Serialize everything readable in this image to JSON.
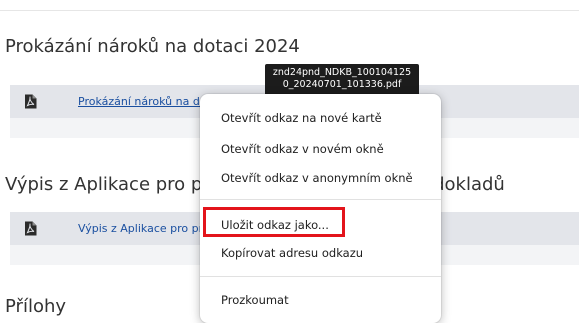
{
  "sections": [
    {
      "heading": "Prokázání nároků na dotaci 2024",
      "file_link": "Prokázání nároků na dotaci 2024"
    },
    {
      "heading": "Výpis z Aplikace pro příjem a kontrolu účetních dokladů",
      "file_link": "Výpis z Aplikace pro příjem a kontrolu účetních dokladů"
    },
    {
      "heading": "Přílohy"
    }
  ],
  "file_icon": "pdf-file-icon",
  "tooltip": {
    "line1": "znd24pnd_NDKB_100104125",
    "line2": "0_20240701_101336.pdf"
  },
  "context_menu": {
    "items": [
      "Otevřít odkaz na nové kartě",
      "Otevřít odkaz v novém okně",
      "Otevřít odkaz v anonymním okně",
      "Uložit odkaz jako...",
      "Kopírovat adresu odkazu",
      "Prozkoumat"
    ]
  },
  "colors": {
    "row_background": "#e3e5ea",
    "link": "#1a4fa0",
    "highlight": "#e3141b",
    "tooltip_background": "#1c1c1c"
  }
}
